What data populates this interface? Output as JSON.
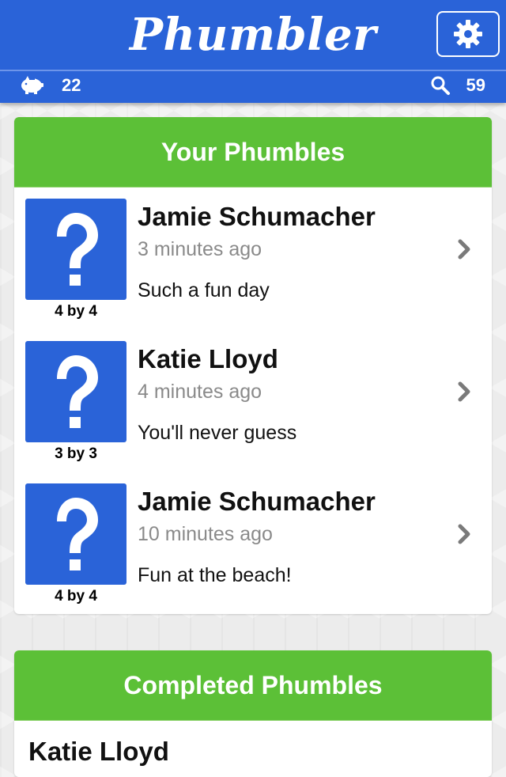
{
  "app": {
    "title": "Phumbler"
  },
  "status": {
    "coins": "22",
    "searches": "59"
  },
  "your_phumbles": {
    "header": "Your Phumbles",
    "items": [
      {
        "name": "Jamie Schumacher",
        "time": "3 minutes ago",
        "message": "Such a fun day",
        "size": "4 by 4"
      },
      {
        "name": "Katie Lloyd",
        "time": "4 minutes ago",
        "message": "You'll never guess",
        "size": "3 by 3"
      },
      {
        "name": "Jamie Schumacher",
        "time": "10 minutes ago",
        "message": "Fun at the beach!",
        "size": "4 by 4"
      }
    ]
  },
  "completed_phumbles": {
    "header": "Completed Phumbles",
    "items": [
      {
        "name": "Katie Lloyd"
      }
    ]
  },
  "colors": {
    "brand_blue": "#2a63d8",
    "header_green": "#5cc037",
    "muted_text": "#8a8a8a"
  },
  "icons": {
    "settings": "gear-icon",
    "coins": "piggy-bank-icon",
    "searches": "search-icon",
    "thumb": "question-mark-icon",
    "row_action": "chevron-right-icon"
  }
}
